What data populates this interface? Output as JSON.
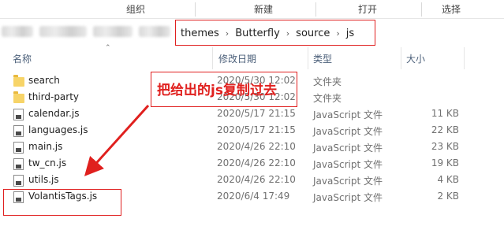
{
  "ribbon": {
    "groups": [
      "组织",
      "新建",
      "打开",
      "选择"
    ]
  },
  "address": {
    "crumbs": [
      "themes",
      "Butterfly",
      "source",
      "js"
    ]
  },
  "columns": {
    "name": "名称",
    "date": "修改日期",
    "type": "类型",
    "size": "大小"
  },
  "files": [
    {
      "name": "search",
      "date": "2020/5/30 12:02",
      "type": "文件夹",
      "size": "",
      "icon": "folder-icon"
    },
    {
      "name": "third-party",
      "date": "2020/5/30 12:02",
      "type": "文件夹",
      "size": "",
      "icon": "folder-icon"
    },
    {
      "name": "calendar.js",
      "date": "2020/5/17 21:15",
      "type": "JavaScript 文件",
      "size": "11 KB",
      "icon": "js-file-icon"
    },
    {
      "name": "languages.js",
      "date": "2020/5/17 21:15",
      "type": "JavaScript 文件",
      "size": "22 KB",
      "icon": "js-file-icon"
    },
    {
      "name": "main.js",
      "date": "2020/4/26 22:10",
      "type": "JavaScript 文件",
      "size": "23 KB",
      "icon": "js-file-icon"
    },
    {
      "name": "tw_cn.js",
      "date": "2020/4/26 22:10",
      "type": "JavaScript 文件",
      "size": "19 KB",
      "icon": "js-file-icon"
    },
    {
      "name": "utils.js",
      "date": "2020/4/26 22:10",
      "type": "JavaScript 文件",
      "size": "4 KB",
      "icon": "js-file-icon"
    },
    {
      "name": "VolantisTags.js",
      "date": "2020/6/4 17:49",
      "type": "JavaScript 文件",
      "size": "2 KB",
      "icon": "js-file-icon"
    }
  ],
  "annotation": {
    "text": "把给出的js复制过去",
    "color": "#e0201e"
  }
}
